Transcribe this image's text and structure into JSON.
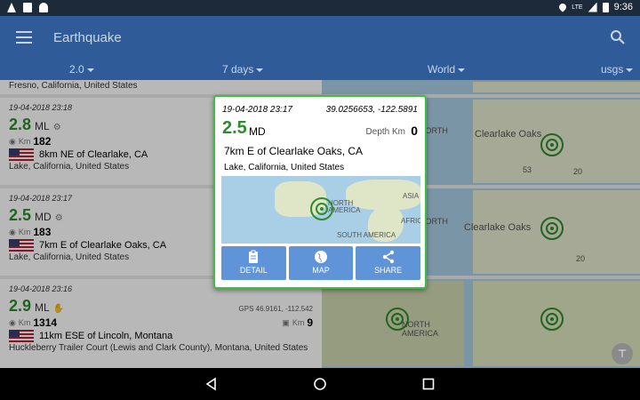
{
  "statusbar": {
    "time": "9:36",
    "signal_label": "LTE"
  },
  "appbar": {
    "title": "Earthquake"
  },
  "filters": {
    "magnitude": "2.0",
    "period": "7 days",
    "region": "World",
    "source": "usgs"
  },
  "list": {
    "top_partial_region": "Fresno, California, United States",
    "items": [
      {
        "date": "19-04-2018 23:18",
        "mag": "2.8",
        "magtype": "ML",
        "km_label": "Km",
        "depth_km": "182",
        "title": "8km NE of Clearlake, CA",
        "region": "Lake, California, United States"
      },
      {
        "date": "19-04-2018 23:17",
        "mag": "2.5",
        "magtype": "MD",
        "km_label": "Km",
        "depth_km": "183",
        "title": "7km E of Clearlake Oaks, CA",
        "region": "Lake, California, United States"
      },
      {
        "date": "19-04-2018 23:16",
        "mag": "2.9",
        "magtype": "ML",
        "km_label": "Km",
        "depth_km": "1314",
        "title": "11km ESE of Lincoln, Montana",
        "region": "Huckleberry Trailer Court (Lewis and Clark County), Montana, United States",
        "gps": "GPS 46.9161, -112.542",
        "gps_km_label": "Km",
        "gps_km": "9"
      }
    ],
    "map_labels": {
      "north": "NORTH",
      "america": "AMERICA",
      "clearlake_oaks": "Clearlake Oaks",
      "route53": "53",
      "route20": "20"
    }
  },
  "popup": {
    "date": "19-04-2018 23:17",
    "coords": "39.0256653, -122.5891",
    "mag": "2.5",
    "magtype": "MD",
    "depth_label": "Depth Km",
    "depth": "0",
    "title": "7km E of Clearlake Oaks, CA",
    "region": "Lake, California, United States",
    "map_labels": {
      "north": "NORTH",
      "america": "AMERICA",
      "africa": "AFRICA",
      "asia": "ASIA",
      "south_america": "SOUTH AMERICA"
    },
    "actions": {
      "detail": "DETAIL",
      "map": "MAP",
      "share": "SHARE"
    }
  },
  "colors": {
    "appbar": "#2f5c98",
    "magnitude": "#2e8b2e",
    "action": "#5f94d8",
    "popup_border": "#3fbf3f"
  }
}
